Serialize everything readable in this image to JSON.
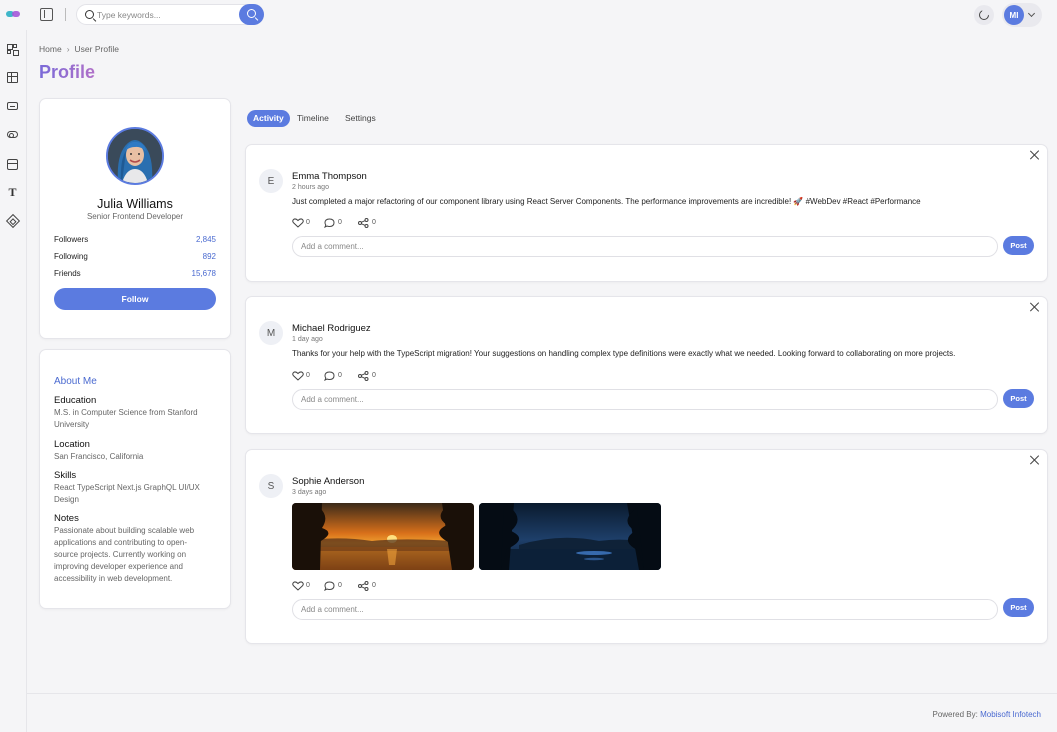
{
  "header": {
    "search_placeholder": "Type keywords...",
    "user_initials": "MI"
  },
  "breadcrumb": {
    "home": "Home",
    "current": "User Profile"
  },
  "page_title": "Profile",
  "profile": {
    "name": "Julia Williams",
    "role": "Senior Frontend Developer",
    "stats": [
      {
        "label": "Followers",
        "value": "2,845"
      },
      {
        "label": "Following",
        "value": "892"
      },
      {
        "label": "Friends",
        "value": "15,678"
      }
    ],
    "follow_label": "Follow"
  },
  "about": {
    "title": "About Me",
    "education_label": "Education",
    "education": "M.S. in Computer Science from Stanford University",
    "location_label": "Location",
    "location": "San Francisco, California",
    "skills_label": "Skills",
    "skills": "React TypeScript Next.js GraphQL UI/UX Design",
    "notes_label": "Notes",
    "notes": "Passionate about building scalable web applications and contributing to open-source projects. Currently working on improving developer experience and accessibility in web development."
  },
  "tabs": [
    {
      "label": "Activity",
      "active": true
    },
    {
      "label": "Timeline",
      "active": false
    },
    {
      "label": "Settings",
      "active": false
    }
  ],
  "posts": [
    {
      "initial": "E",
      "author": "Emma Thompson",
      "time": "2 hours ago",
      "text": "Just completed a major refactoring of our component library using React Server Components. The performance improvements are incredible! 🚀 #WebDev #React #Performance",
      "likes": "0",
      "comments": "0",
      "shares": "0",
      "comment_placeholder": "Add a comment...",
      "post_label": "Post"
    },
    {
      "initial": "M",
      "author": "Michael Rodriguez",
      "time": "1 day ago",
      "text": "Thanks for your help with the TypeScript migration! Your suggestions on handling complex type definitions were exactly what we needed. Looking forward to collaborating on more projects.",
      "likes": "0",
      "comments": "0",
      "shares": "0",
      "comment_placeholder": "Add a comment...",
      "post_label": "Post"
    },
    {
      "initial": "S",
      "author": "Sophie Anderson",
      "time": "3 days ago",
      "text": "",
      "likes": "0",
      "comments": "0",
      "shares": "0",
      "comment_placeholder": "Add a comment...",
      "post_label": "Post"
    }
  ],
  "footer": {
    "prefix": "Powered By:",
    "brand": "Mobisoft Infotech"
  }
}
